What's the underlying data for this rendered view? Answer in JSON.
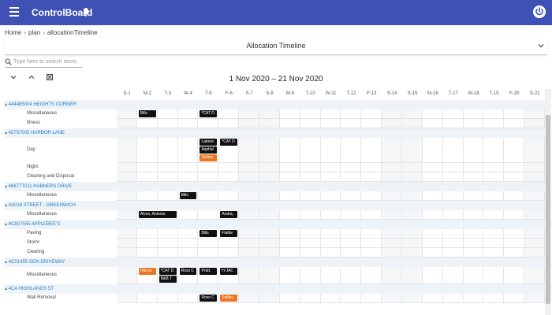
{
  "app": {
    "title": "ControlBoard"
  },
  "breadcrumb": [
    "Home",
    "plan",
    "allocationTimeline"
  ],
  "view_select": {
    "value": "Allocation Timeline"
  },
  "search": {
    "placeholder": "Type here to search items"
  },
  "date_range": "1 Nov 2020 – 21 Nov 2020",
  "days": [
    "S-1",
    "M-2",
    "T-3",
    "W-4",
    "T-5",
    "F-6",
    "S-7",
    "S-8",
    "M-9",
    "T-10",
    "W-11",
    "T-12",
    "F-13",
    "S-14",
    "S-15",
    "M-16",
    "T-17",
    "W-18",
    "T-19",
    "F-20",
    "S-21"
  ],
  "weekend_days": [
    0,
    6,
    7,
    13,
    14,
    20
  ],
  "groups": [
    {
      "name": "444485004 HEIGHTS CORNER",
      "rows": [
        {
          "label": "Miscellaneous",
          "chips": [
            {
              "text": "Bills",
              "day": 1
            },
            {
              "text": "*CAT D",
              "day": 4
            }
          ]
        },
        {
          "label": "Illness",
          "chips": []
        }
      ]
    },
    {
      "name": "45757005 HARBOR LANE",
      "rows": [
        {
          "label": "Day",
          "tall": true,
          "chips": [
            {
              "text": "Labore",
              "day": 4,
              "line": 0
            },
            {
              "text": "*CAT D",
              "day": 5,
              "line": 0
            },
            {
              "text": "Asphal",
              "day": 4,
              "line": 1
            },
            {
              "text": "Sullivs",
              "day": 4,
              "line": 2,
              "color": "orange"
            }
          ]
        },
        {
          "label": "Night",
          "chips": []
        },
        {
          "label": "Cleaning and Disposal",
          "chips": []
        }
      ]
    },
    {
      "name": "46677T011 HABNERS DRIVE",
      "rows": [
        {
          "label": "Miscellaneous",
          "chips": [
            {
              "text": "Bills",
              "day": 3
            }
          ]
        }
      ]
    },
    {
      "name": "4A016 STREET - GREENWICH",
      "rows": [
        {
          "label": "Miscellaneous",
          "chips": [
            {
              "text": "Alves, Antonio",
              "day": 1,
              "span": 2
            },
            {
              "text": "Andra,",
              "day": 5
            }
          ]
        }
      ]
    },
    {
      "name": "4C807555 APPLEBEE'S",
      "rows": [
        {
          "label": "Paving",
          "chips": [
            {
              "text": "Bills",
              "day": 4
            },
            {
              "text": "Flatbe",
              "day": 5
            }
          ]
        },
        {
          "label": "Storm",
          "chips": []
        },
        {
          "label": "Clearing",
          "chips": []
        }
      ]
    },
    {
      "name": "4C01455 SON DRIVEWAY",
      "rows": [
        {
          "label": "Miscellaneous",
          "tall2": true,
          "chips": [
            {
              "text": "Harrys",
              "day": 1,
              "line": 0,
              "color": "orange"
            },
            {
              "text": "*CAT D",
              "day": 2,
              "line": 0
            },
            {
              "text": "Ross C",
              "day": 3,
              "line": 0
            },
            {
              "text": "Pratt,",
              "day": 4,
              "line": 0
            },
            {
              "text": "H-JAC",
              "day": 5,
              "line": 0
            },
            {
              "text": "B&B T",
              "day": 2,
              "line": 1
            }
          ]
        }
      ]
    },
    {
      "name": "4CA HIGHLANDS ST",
      "rows": [
        {
          "label": "Wall Removal",
          "chips": [
            {
              "text": "Ross C",
              "day": 4
            },
            {
              "text": "Sullivs",
              "day": 5,
              "color": "orange"
            }
          ]
        }
      ]
    }
  ],
  "colors": {
    "appbar": "#3f51b5",
    "group_text": "#1e7bc4",
    "chip": "#111111",
    "chip_orange": "#e87722"
  }
}
